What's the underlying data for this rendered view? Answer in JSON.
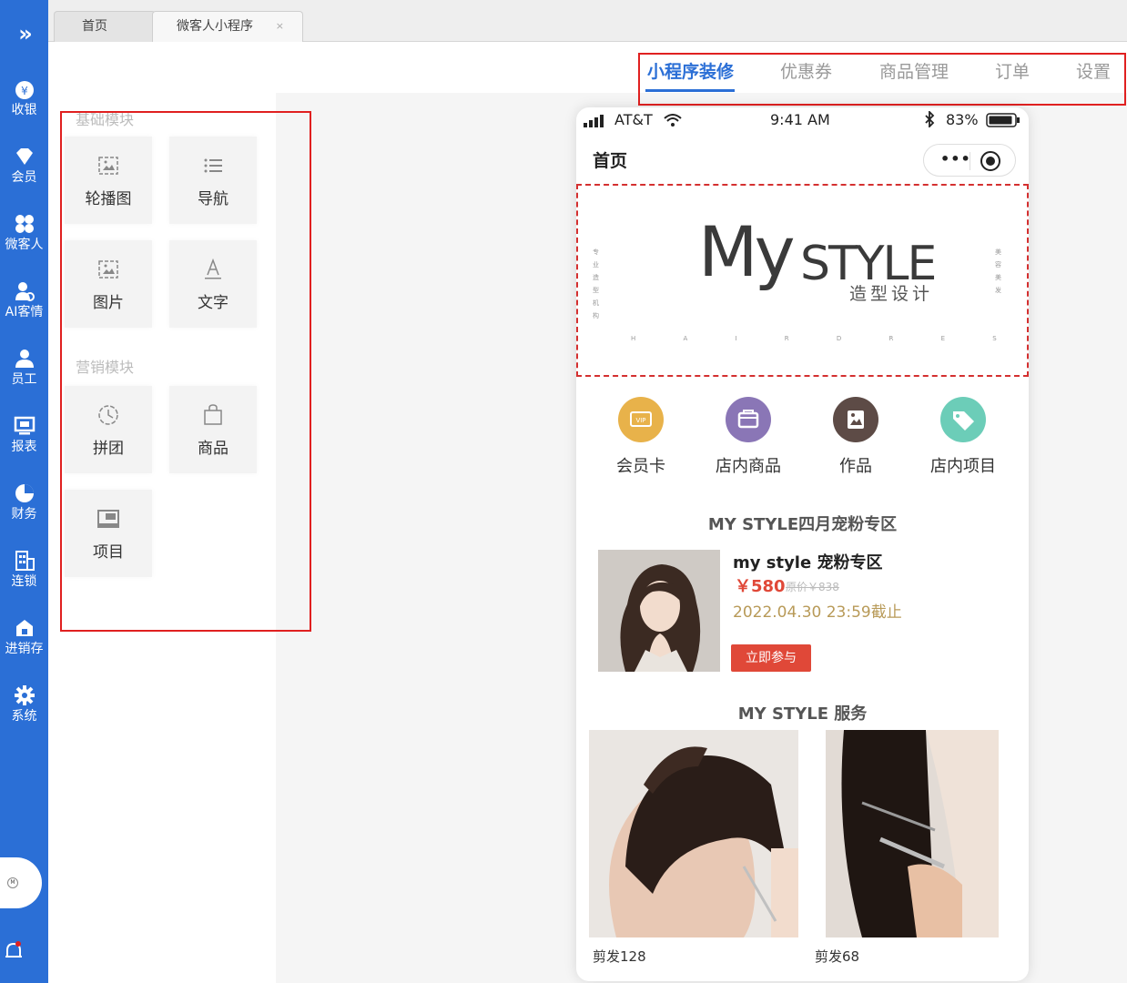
{
  "sidebar": {
    "toggle_glyph": "»",
    "items": [
      {
        "label": "收银",
        "icon": "cashier-icon"
      },
      {
        "label": "会员",
        "icon": "member-icon"
      },
      {
        "label": "微客人",
        "icon": "grid-icon"
      },
      {
        "label": "AI客情",
        "icon": "ai-customer-icon"
      },
      {
        "label": "员工",
        "icon": "staff-icon"
      },
      {
        "label": "报表",
        "icon": "report-icon"
      },
      {
        "label": "财务",
        "icon": "finance-icon"
      },
      {
        "label": "连锁",
        "icon": "chain-icon"
      },
      {
        "label": "进销存",
        "icon": "inventory-icon"
      },
      {
        "label": "系统",
        "icon": "settings-icon"
      }
    ],
    "avatar_text": "M"
  },
  "tabs": {
    "home": "首页",
    "active": "微客人小程序",
    "close_glyph": "×"
  },
  "topnav": {
    "items": [
      "小程序装修",
      "优惠券",
      "商品管理",
      "订单",
      "设置"
    ],
    "active_index": 0
  },
  "panel": {
    "basic_title": "基础模块",
    "basic_items": [
      "轮播图",
      "导航",
      "图片",
      "文字"
    ],
    "marketing_title": "营销模块",
    "marketing_items": [
      "拼团",
      "商品",
      "项目"
    ]
  },
  "phone": {
    "carrier": "AT&T",
    "time": "9:41 AM",
    "battery": "83%",
    "page_title": "首页",
    "capsule_more": "•••",
    "banner": {
      "logo_main": "My",
      "logo_style": "STYLE",
      "logo_sub": "造型设计",
      "logo_dots": "H A I R D R E S S I N G",
      "side_left": "专业造型机构",
      "side_right": "美容美发"
    },
    "quicknav": [
      {
        "label": "会员卡",
        "color": "#e8b24a",
        "icon": "vip-card-icon"
      },
      {
        "label": "店内商品",
        "color": "#8a76b6",
        "icon": "shop-icon"
      },
      {
        "label": "作品",
        "color": "#5d4b46",
        "icon": "gallery-icon"
      },
      {
        "label": "店内项目",
        "color": "#6ccdb8",
        "icon": "tag-icon"
      }
    ],
    "promo_section": "MY STYLE四月宠粉专区",
    "promo": {
      "name": "my style 宠粉专区",
      "price": "￥580",
      "original": "原价￥838",
      "deadline": "2022.04.30 23:59截止",
      "button": "立即参与"
    },
    "service_section": "MY STYLE 服务",
    "services": [
      "剪发128",
      "剪发68"
    ]
  },
  "colors": {
    "sidebar": "#2b6fd6",
    "accent": "#2b6fd6",
    "highlight_box": "#e02020",
    "price": "#e04838"
  }
}
